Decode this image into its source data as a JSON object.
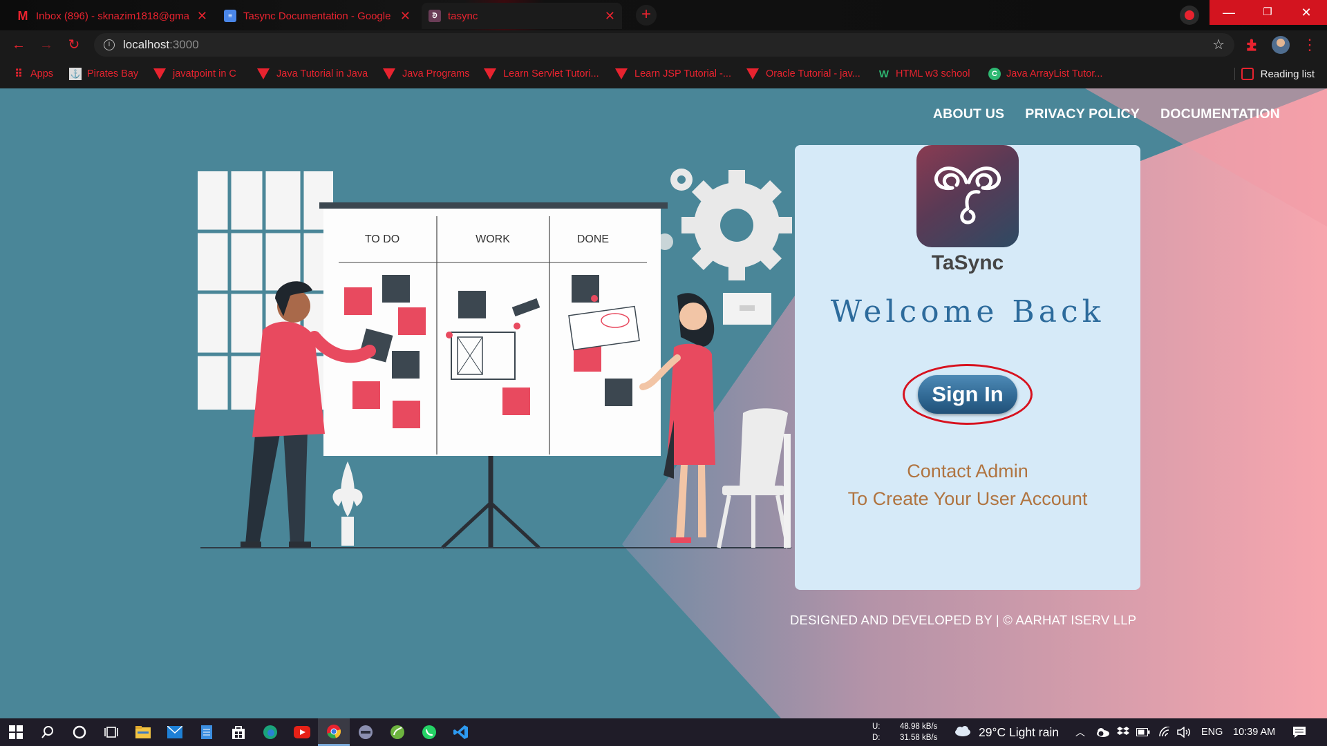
{
  "browser": {
    "tabs": [
      {
        "title": "Inbox (896) - sknazim1818@gma",
        "icon": "gmail-icon"
      },
      {
        "title": "Tasync Documentation - Google",
        "icon": "docs-icon"
      },
      {
        "title": "tasync",
        "icon": "tasync-icon"
      }
    ],
    "address": {
      "host": "localhost",
      "port": ":3000"
    },
    "bookmarks": [
      {
        "label": "Apps"
      },
      {
        "label": "Pirates Bay"
      },
      {
        "label": "javatpoint in C"
      },
      {
        "label": "Java Tutorial in Java"
      },
      {
        "label": "Java Programs"
      },
      {
        "label": "Learn Servlet Tutori..."
      },
      {
        "label": "Learn JSP Tutorial -..."
      },
      {
        "label": "Oracle Tutorial - jav..."
      },
      {
        "label": "HTML w3 school"
      },
      {
        "label": "Java ArrayList Tutor..."
      }
    ],
    "reading_list": "Reading list"
  },
  "nav": {
    "about": "ABOUT US",
    "privacy": "PRIVACY POLICY",
    "docs": "DOCUMENTATION"
  },
  "board": {
    "col1": "TO DO",
    "col2": "WORK",
    "col3": "DONE"
  },
  "login": {
    "brand": "TaSync",
    "welcome": "Welcome Back",
    "signin_label": "Sign In",
    "contact_line1": "Contact Admin",
    "contact_line2": "To Create Your User Account"
  },
  "footer": {
    "credit": "DESIGNED AND DEVELOPED BY | © AARHAT ISERV LLP"
  },
  "taskbar": {
    "upload_label": "U:",
    "upload": "48.98 kB/s",
    "download_label": "D:",
    "download": "31.58 kB/s",
    "weather": "29°C  Light rain",
    "lang": "ENG",
    "time": "10:39 AM"
  },
  "colors": {
    "accent_red": "#e8232f",
    "page_teal": "#4a8698",
    "page_pink": "#f7a8b0",
    "card_bg": "#d6eaf8",
    "welcome_blue": "#2d6b9c",
    "contact_brown": "#b07440"
  }
}
